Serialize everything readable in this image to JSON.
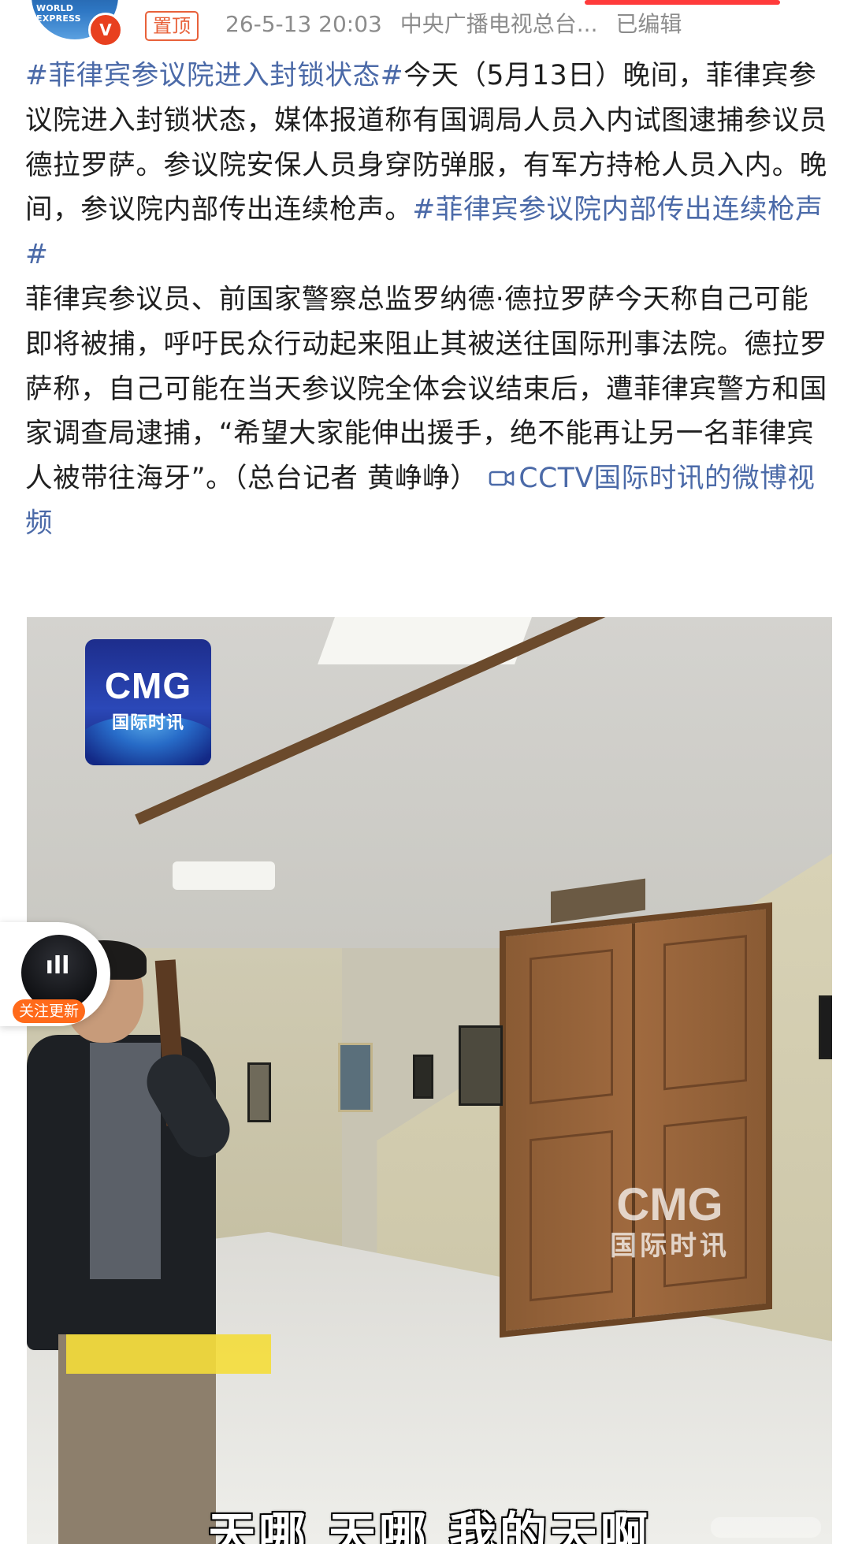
{
  "header": {
    "avatar_text": "WORLD EXPRESS",
    "verified_badge": "V",
    "pinned_label": "置顶",
    "timestamp": "26-5-13 20:03",
    "source": "中央广播电视总台...",
    "edited_label": "已编辑"
  },
  "post": {
    "tag1": "#菲律宾参议院进入封锁状态#",
    "text1": "今天（5月13日）晚间，菲律宾参议院进入封锁状态，媒体报道称有国调局人员入内试图逮捕参议员德拉罗萨。参议院安保人员身穿防弹服，有军方持枪人员入内。晚间，参议院内部传出连续枪声。",
    "tag2": "#菲律宾参议院内部传出连续枪声#",
    "text2": "菲律宾参议员、前国家警察总监罗纳德·德拉罗萨今天称自己可能即将被捕，呼吁民众行动起来阻止其被送往国际刑事法院。德拉罗萨称，自己可能在当天参议院全体会议结束后，遭菲律宾警方和国家调查局逮捕，“希望大家能伸出援手，绝不能再让另一名菲律宾人被带往海牙”。（总台记者 黄峥峥）",
    "video_link_icon": "video-camera-icon",
    "video_link": "CCTV国际时讯的微博视频"
  },
  "video": {
    "logo_main": "CMG",
    "logo_sub": "国际时讯",
    "watermark_main": "CMG",
    "watermark_sub": "国际时讯",
    "subtitle": "天哪 天哪 我的天啊"
  },
  "follow_widget": {
    "label": "关注更新"
  },
  "colors": {
    "link": "#4b6aa8",
    "accent_orange": "#ff6a1a",
    "pinned": "#e8613a",
    "verified": "#e8401f"
  }
}
